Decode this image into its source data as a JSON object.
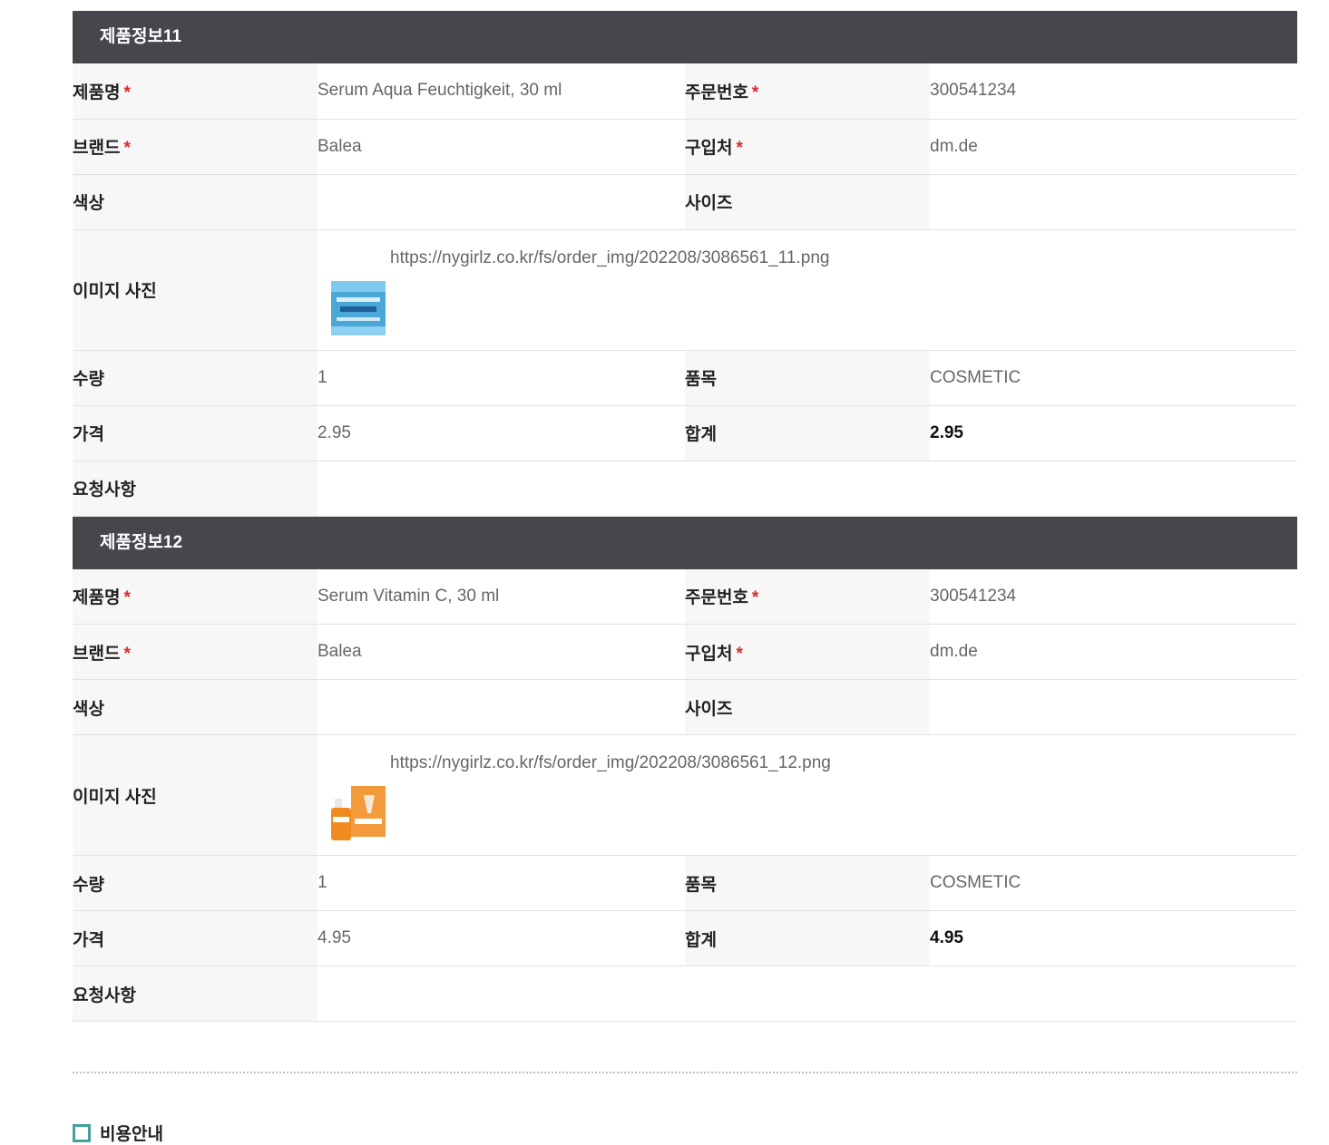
{
  "products": [
    {
      "header": "제품정보11",
      "name_label": "제품명",
      "name": "Serum Aqua Feuchtigkeit, 30 ml",
      "order_label": "주문번호",
      "order_no": "300541234",
      "brand_label": "브랜드",
      "brand": "Balea",
      "store_label": "구입처",
      "store": "dm.de",
      "color_label": "색상",
      "color": "",
      "size_label": "사이즈",
      "size": "",
      "image_label": "이미지 사진",
      "image_url": "https://nygirlz.co.kr/fs/order_img/202208/3086561_11.png",
      "qty_label": "수량",
      "qty": "1",
      "category_label": "품목",
      "category": "COSMETIC",
      "price_label": "가격",
      "price": "2.95",
      "total_label": "합계",
      "total": "2.95",
      "request_label": "요청사항",
      "request": ""
    },
    {
      "header": "제품정보12",
      "name_label": "제품명",
      "name": "Serum Vitamin C, 30 ml",
      "order_label": "주문번호",
      "order_no": "300541234",
      "brand_label": "브랜드",
      "brand": "Balea",
      "store_label": "구입처",
      "store": "dm.de",
      "color_label": "색상",
      "color": "",
      "size_label": "사이즈",
      "size": "",
      "image_label": "이미지 사진",
      "image_url": "https://nygirlz.co.kr/fs/order_img/202208/3086561_12.png",
      "qty_label": "수량",
      "qty": "1",
      "category_label": "품목",
      "category": "COSMETIC",
      "price_label": "가격",
      "price": "4.95",
      "total_label": "합계",
      "total": "4.95",
      "request_label": "요청사항",
      "request": ""
    }
  ],
  "required_mark": "*",
  "fee_section": {
    "title": "비용안내"
  },
  "colors": {
    "header_bg": "#46474d",
    "label_bg": "#f7f7f7",
    "required": "#e0262b",
    "accent": "#3fa39a"
  }
}
